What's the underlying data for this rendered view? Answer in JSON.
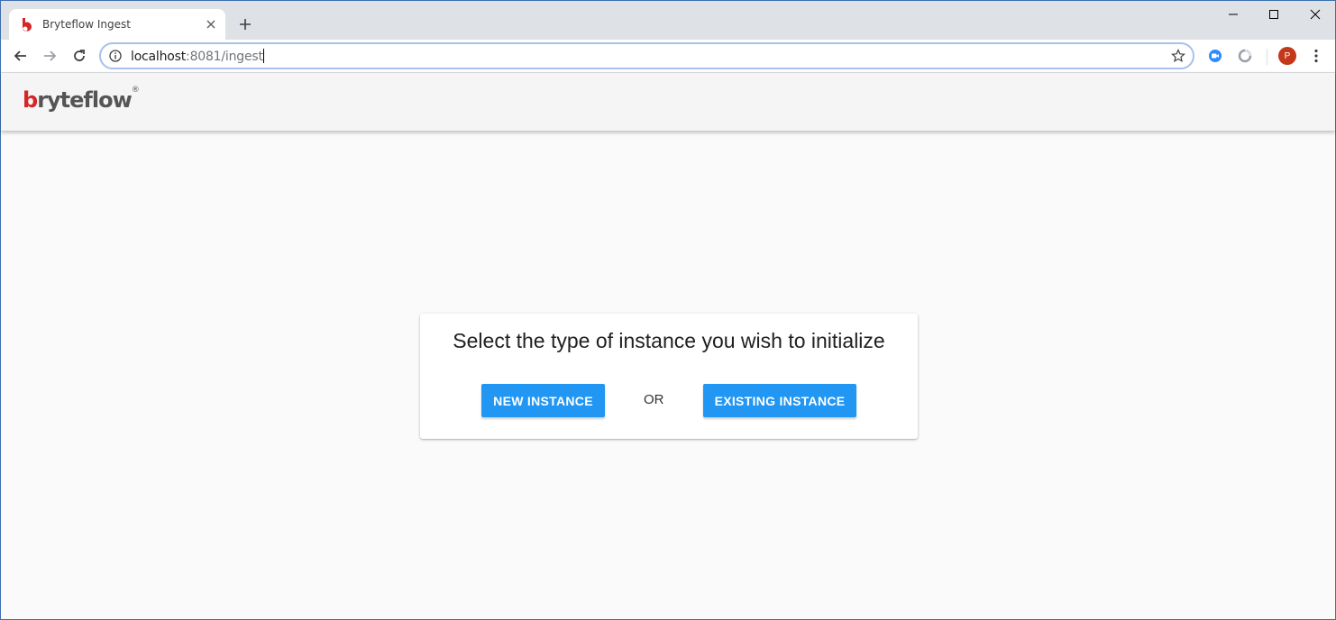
{
  "browser": {
    "tab_title": "Bryteflow Ingest",
    "url_host": "localhost",
    "url_path": ":8081/ingest",
    "avatar_letter": "P",
    "accent": "#2196f3"
  },
  "header": {
    "logo_part1": "b",
    "logo_part2": "ryte",
    "logo_part3": "flow",
    "logo_reg": "®"
  },
  "dialog": {
    "title": "Select the type of instance you wish to initialize",
    "new_button": "NEW INSTANCE",
    "or_label": "OR",
    "existing_button": "EXISTING INSTANCE"
  }
}
